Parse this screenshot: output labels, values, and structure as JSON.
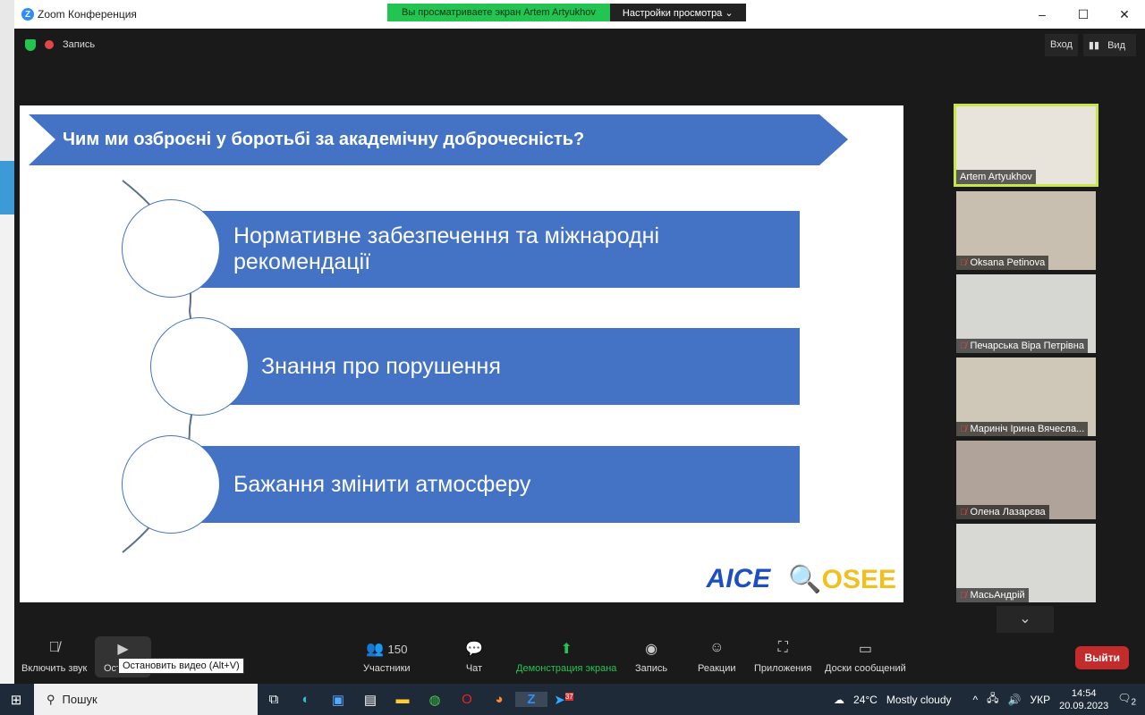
{
  "window": {
    "title": "Zoom Конференция",
    "minimize": "–",
    "maximize": "☐",
    "close": "✕"
  },
  "banner": {
    "viewing": "Вы просматриваете экран Artem Artyukhov",
    "settings": "Настройки просмотра",
    "chevron": "⌄"
  },
  "topbar": {
    "record": "Запись",
    "enter": "Вход",
    "view": "Вид"
  },
  "slide": {
    "title": "Чим ми озброєні у боротьбі за академічну доброчесність?",
    "items": [
      "Нормативне забезпечення та міжнародні рекомендації",
      "Знання про порушення",
      "Бажання змінити атмосферу"
    ],
    "logo1": "AICE",
    "logo2": "OSEE"
  },
  "participants": [
    {
      "name": "Artem Artyukhov",
      "active": true,
      "muted": false
    },
    {
      "name": "Oksana Petinova",
      "muted": true
    },
    {
      "name": "Печарська Віра Петрівна",
      "muted": true
    },
    {
      "name": "Мариніч Ірина Вячесла...",
      "muted": true
    },
    {
      "name": "Олена Лазарєва",
      "muted": true
    },
    {
      "name": "МасьАндрій",
      "muted": true
    }
  ],
  "toolbar": {
    "unmute": "Включить звук",
    "video": "Останов",
    "participants": "Участники",
    "participants_count": "150",
    "chat": "Чат",
    "share": "Демонстрация экрана",
    "record": "Запись",
    "reactions": "Реакции",
    "apps": "Приложения",
    "whiteboards": "Доски сообщений",
    "leave": "Выйти",
    "tooltip": "Остановить видео (Alt+V)"
  },
  "taskbar": {
    "search": "Пошук",
    "weather_temp": "24°C",
    "weather_desc": "Mostly cloudy",
    "lang": "УКР",
    "time": "14:54",
    "date": "20.09.2023",
    "notif_count": "2",
    "telegram_badge": "37"
  }
}
